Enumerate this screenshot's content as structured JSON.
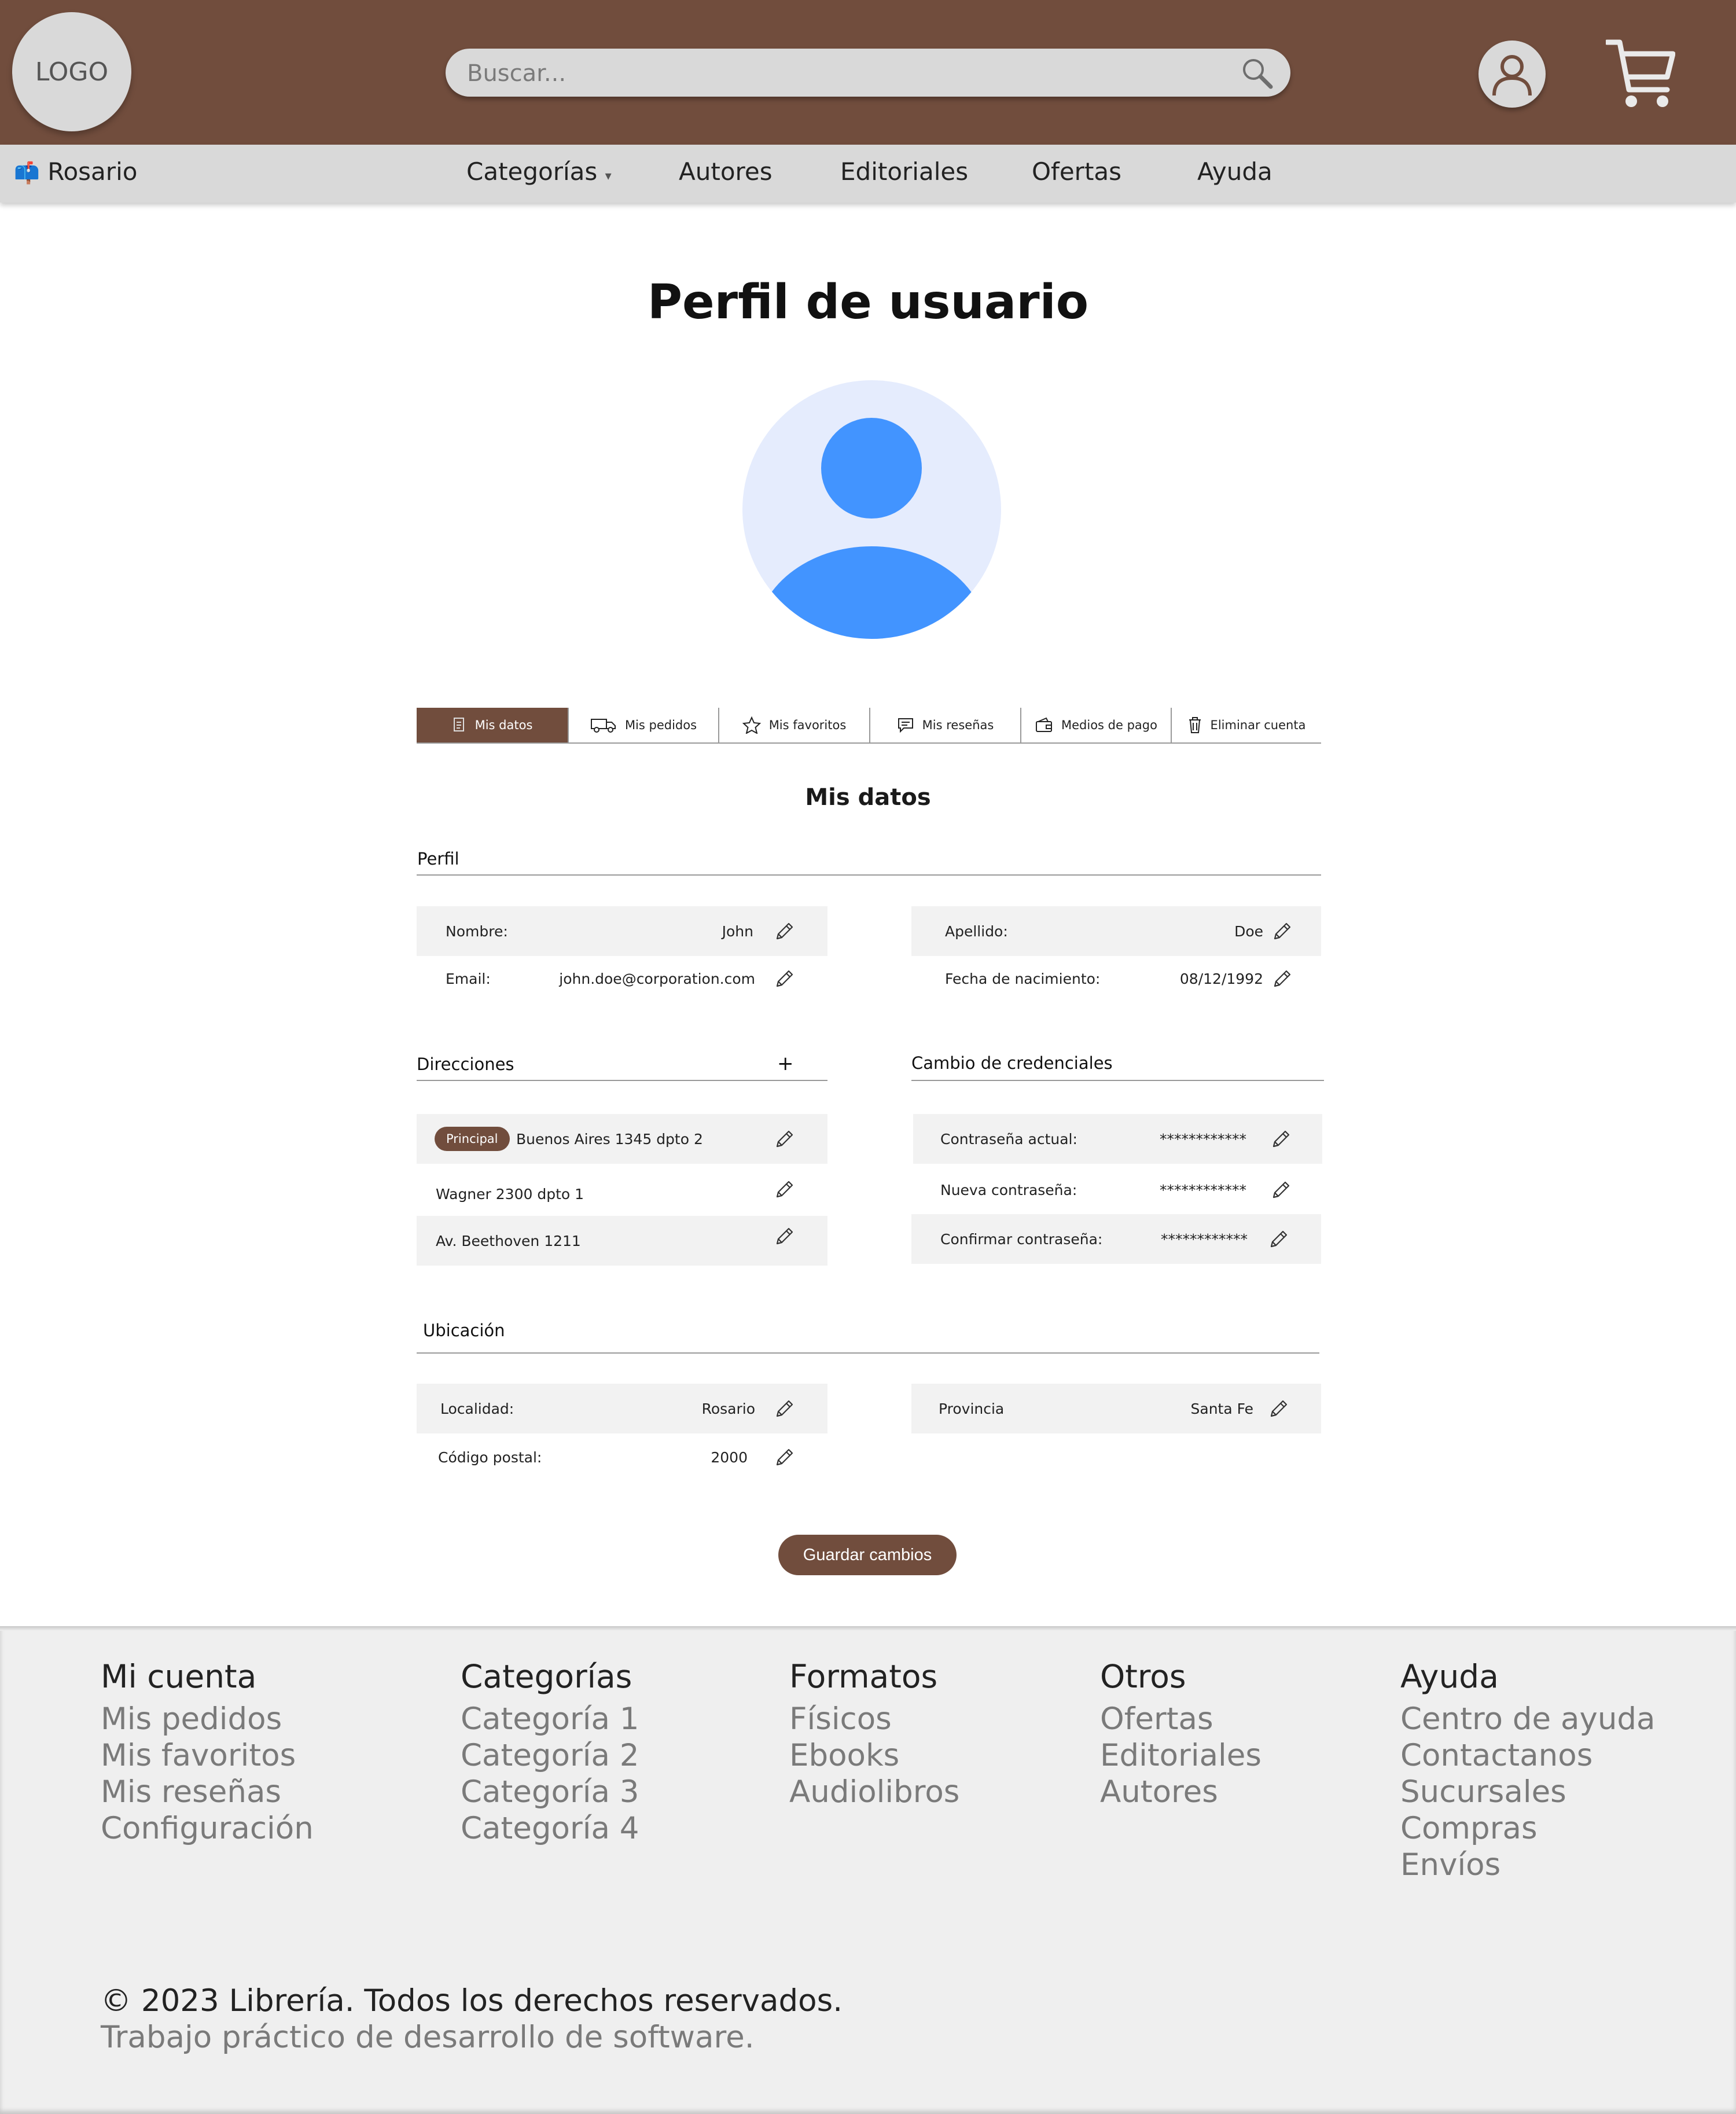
{
  "header": {
    "logo_text": "LOGO",
    "search_placeholder": "Buscar...",
    "brand_color": "#714d3d"
  },
  "nav": {
    "location_icon": "mailbox-icon",
    "location": "Rosario",
    "items": [
      "Categorías",
      "Autores",
      "Editoriales",
      "Ofertas",
      "Ayuda"
    ]
  },
  "page_title": "Perfil de usuario",
  "tabs": [
    {
      "label": "Mis datos",
      "icon": "document-icon",
      "active": true
    },
    {
      "label": "Mis pedidos",
      "icon": "truck-icon",
      "active": false
    },
    {
      "label": "Mis favoritos",
      "icon": "star-icon",
      "active": false
    },
    {
      "label": "Mis reseñas",
      "icon": "comment-icon",
      "active": false
    },
    {
      "label": "Medios de pago",
      "icon": "wallet-icon",
      "active": false
    },
    {
      "label": "Eliminar cuenta",
      "icon": "trash-icon",
      "active": false
    }
  ],
  "section_title": "Mis datos",
  "perfil": {
    "title": "Perfil",
    "nombre_label": "Nombre:",
    "nombre": "John",
    "apellido_label": "Apellido:",
    "apellido": "Doe",
    "email_label": "Email:",
    "email": "john.doe@corporation.com",
    "fecha_label": "Fecha de nacimiento:",
    "fecha": "08/12/1992"
  },
  "direcciones": {
    "title": "Direcciones",
    "add_symbol": "+",
    "principal_badge": "Principal",
    "items": [
      "Buenos Aires 1345 dpto 2",
      "Wagner 2300 dpto 1",
      "Av. Beethoven 1211"
    ]
  },
  "credenciales": {
    "title": "Cambio de credenciales",
    "actual_label": "Contraseña actual:",
    "nueva_label": "Nueva contraseña:",
    "confirmar_label": "Confirmar contraseña:",
    "masked": "************"
  },
  "ubicacion": {
    "title": "Ubicación",
    "localidad_label": "Localidad:",
    "localidad": "Rosario",
    "provincia_label": "Provincia",
    "provincia": "Santa Fe",
    "cp_label": "Código postal:",
    "cp": "2000"
  },
  "save_label": "Guardar cambios",
  "footer": {
    "columns": [
      {
        "title": "Mi cuenta",
        "links": [
          "Mis pedidos",
          "Mis favoritos",
          "Mis reseñas",
          "Configuración"
        ]
      },
      {
        "title": "Categorías",
        "links": [
          "Categoría 1",
          "Categoría 2",
          "Categoría 3",
          "Categoría 4"
        ]
      },
      {
        "title": "Formatos",
        "links": [
          "Físicos",
          "Ebooks",
          "Audiolibros"
        ]
      },
      {
        "title": "Otros",
        "links": [
          "Ofertas",
          "Editoriales",
          "Autores"
        ]
      },
      {
        "title": "Ayuda",
        "links": [
          "Centro de ayuda",
          "Contactanos",
          "Sucursales",
          "Compras",
          "Envíos"
        ]
      }
    ],
    "copyright": "© 2023 Librería. Todos los derechos reservados.",
    "credit": "Trabajo práctico de desarrollo de software."
  }
}
